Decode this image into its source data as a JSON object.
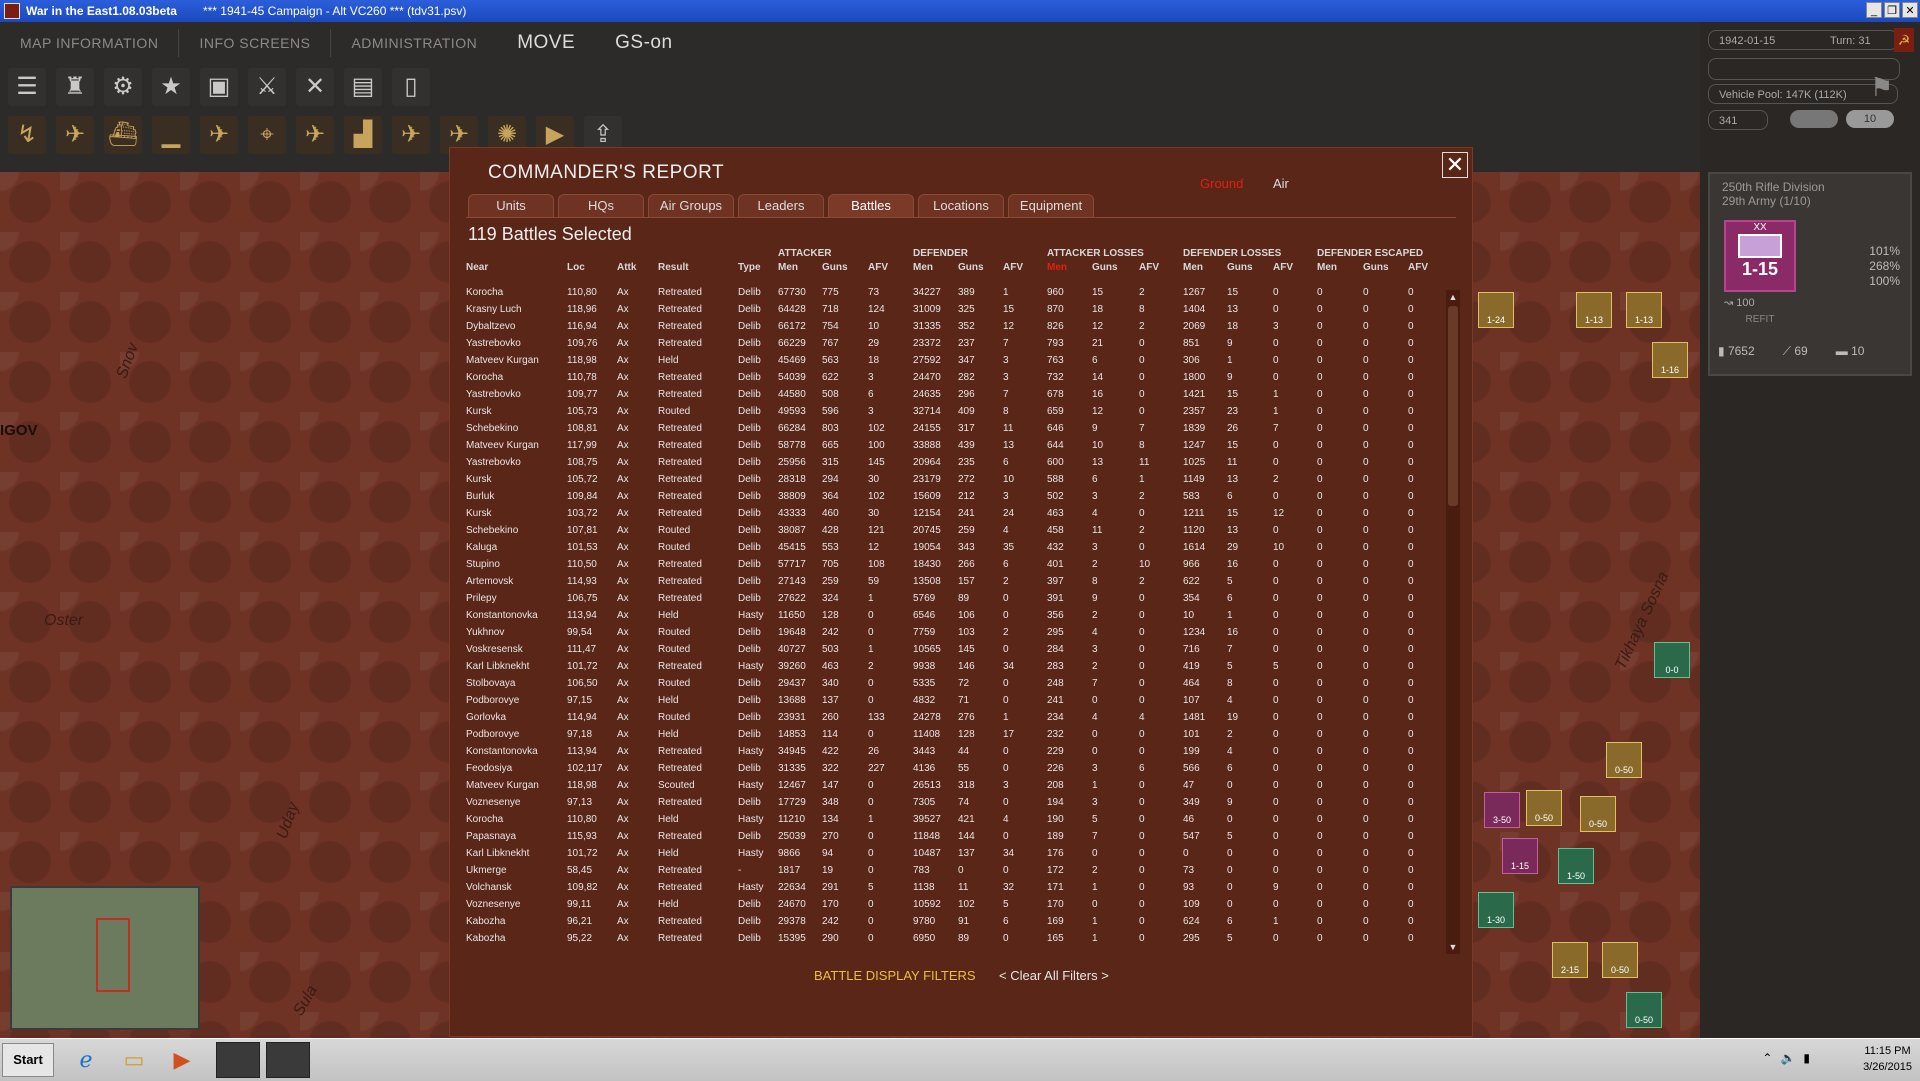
{
  "window": {
    "title": "War in the East1.08.03beta",
    "subtitle": "***  1941-45 Campaign - Alt VC260  ***  (tdv31.psv)"
  },
  "menu": {
    "map_information": "MAP INFORMATION",
    "info_screens": "INFO SCREENS",
    "administration": "ADMINISTRATION",
    "move": "MOVE",
    "gs_on": "GS-on"
  },
  "status": {
    "date": "1942-01-15",
    "turn": "Turn: 31",
    "vehicle_pool": "Vehicle Pool: 147K (112K)",
    "num": "341",
    "pill": "10"
  },
  "unit": {
    "name": "250th Rifle Division",
    "army": "29th Army (1/10)",
    "corps_mark": "XX",
    "strength": "1-15",
    "pct1": "101%",
    "pct2": "268%",
    "pct3": "100%",
    "support": "100",
    "refit": "REFIT",
    "men": "7652",
    "guns": "69",
    "afv": "10"
  },
  "map": {
    "city": "IGOV",
    "river1": "Snov",
    "river2": "Oster",
    "river3": "Uday",
    "river4": "Sula",
    "river5": "Tikhaya Sosna"
  },
  "dialog": {
    "title": "COMMANDER'S REPORT",
    "filter_ground": "Ground",
    "filter_air": "Air",
    "tabs": [
      "Units",
      "HQs",
      "Air Groups",
      "Leaders",
      "Battles",
      "Locations",
      "Equipment"
    ],
    "selected": "119 Battles Selected",
    "groups": {
      "attacker": "ATTACKER",
      "defender": "DEFENDER",
      "att_losses": "ATTACKER LOSSES",
      "def_losses": "DEFENDER LOSSES",
      "def_escaped": "DEFENDER ESCAPED"
    },
    "headers": {
      "near": "Near",
      "loc": "Loc",
      "attk": "Attk",
      "result": "Result",
      "type": "Type",
      "men": "Men",
      "guns": "Guns",
      "afv": "AFV"
    },
    "filters_label": "BATTLE DISPLAY FILTERS",
    "clear_filters": "< Clear All Filters >",
    "rows": [
      [
        "Korocha",
        "110,80",
        "Ax",
        "Retreated",
        "Delib",
        "67730",
        "775",
        "73",
        "34227",
        "389",
        "1",
        "960",
        "15",
        "2",
        "1267",
        "15",
        "0",
        "0",
        "0",
        "0"
      ],
      [
        "Krasny Luch",
        "118,96",
        "Ax",
        "Retreated",
        "Delib",
        "64428",
        "718",
        "124",
        "31009",
        "325",
        "15",
        "870",
        "18",
        "8",
        "1404",
        "13",
        "0",
        "0",
        "0",
        "0"
      ],
      [
        "Dybaltzevo",
        "116,94",
        "Ax",
        "Retreated",
        "Delib",
        "66172",
        "754",
        "10",
        "31335",
        "352",
        "12",
        "826",
        "12",
        "2",
        "2069",
        "18",
        "3",
        "0",
        "0",
        "0"
      ],
      [
        "Yastrebovko",
        "109,76",
        "Ax",
        "Retreated",
        "Delib",
        "66229",
        "767",
        "29",
        "23372",
        "237",
        "7",
        "793",
        "21",
        "0",
        "851",
        "9",
        "0",
        "0",
        "0",
        "0"
      ],
      [
        "Matveev Kurgan",
        "118,98",
        "Ax",
        "Held",
        "Delib",
        "45469",
        "563",
        "18",
        "27592",
        "347",
        "3",
        "763",
        "6",
        "0",
        "306",
        "1",
        "0",
        "0",
        "0",
        "0"
      ],
      [
        "Korocha",
        "110,78",
        "Ax",
        "Retreated",
        "Delib",
        "54039",
        "622",
        "3",
        "24470",
        "282",
        "3",
        "732",
        "14",
        "0",
        "1800",
        "9",
        "0",
        "0",
        "0",
        "0"
      ],
      [
        "Yastrebovko",
        "109,77",
        "Ax",
        "Retreated",
        "Delib",
        "44580",
        "508",
        "6",
        "24635",
        "296",
        "7",
        "678",
        "16",
        "0",
        "1421",
        "15",
        "1",
        "0",
        "0",
        "0"
      ],
      [
        "Kursk",
        "105,73",
        "Ax",
        "Routed",
        "Delib",
        "49593",
        "596",
        "3",
        "32714",
        "409",
        "8",
        "659",
        "12",
        "0",
        "2357",
        "23",
        "1",
        "0",
        "0",
        "0"
      ],
      [
        "Schebekino",
        "108,81",
        "Ax",
        "Retreated",
        "Delib",
        "66284",
        "803",
        "102",
        "24155",
        "317",
        "11",
        "646",
        "9",
        "7",
        "1839",
        "26",
        "7",
        "0",
        "0",
        "0"
      ],
      [
        "Matveev Kurgan",
        "117,99",
        "Ax",
        "Retreated",
        "Delib",
        "58778",
        "665",
        "100",
        "33888",
        "439",
        "13",
        "644",
        "10",
        "8",
        "1247",
        "15",
        "0",
        "0",
        "0",
        "0"
      ],
      [
        "Yastrebovko",
        "108,75",
        "Ax",
        "Retreated",
        "Delib",
        "25956",
        "315",
        "145",
        "20964",
        "235",
        "6",
        "600",
        "13",
        "11",
        "1025",
        "11",
        "0",
        "0",
        "0",
        "0"
      ],
      [
        "Kursk",
        "105,72",
        "Ax",
        "Retreated",
        "Delib",
        "28318",
        "294",
        "30",
        "23179",
        "272",
        "10",
        "588",
        "6",
        "1",
        "1149",
        "13",
        "2",
        "0",
        "0",
        "0"
      ],
      [
        "Burluk",
        "109,84",
        "Ax",
        "Retreated",
        "Delib",
        "38809",
        "364",
        "102",
        "15609",
        "212",
        "3",
        "502",
        "3",
        "2",
        "583",
        "6",
        "0",
        "0",
        "0",
        "0"
      ],
      [
        "Kursk",
        "103,72",
        "Ax",
        "Retreated",
        "Delib",
        "43333",
        "460",
        "30",
        "12154",
        "241",
        "24",
        "463",
        "4",
        "0",
        "1211",
        "15",
        "12",
        "0",
        "0",
        "0"
      ],
      [
        "Schebekino",
        "107,81",
        "Ax",
        "Routed",
        "Delib",
        "38087",
        "428",
        "121",
        "20745",
        "259",
        "4",
        "458",
        "11",
        "2",
        "1120",
        "13",
        "0",
        "0",
        "0",
        "0"
      ],
      [
        "Kaluga",
        "101,53",
        "Ax",
        "Routed",
        "Delib",
        "45415",
        "553",
        "12",
        "19054",
        "343",
        "35",
        "432",
        "3",
        "0",
        "1614",
        "29",
        "10",
        "0",
        "0",
        "0"
      ],
      [
        "Stupino",
        "110,50",
        "Ax",
        "Retreated",
        "Delib",
        "57717",
        "705",
        "108",
        "18430",
        "266",
        "6",
        "401",
        "2",
        "10",
        "966",
        "16",
        "0",
        "0",
        "0",
        "0"
      ],
      [
        "Artemovsk",
        "114,93",
        "Ax",
        "Retreated",
        "Delib",
        "27143",
        "259",
        "59",
        "13508",
        "157",
        "2",
        "397",
        "8",
        "2",
        "622",
        "5",
        "0",
        "0",
        "0",
        "0"
      ],
      [
        "Prilepy",
        "106,75",
        "Ax",
        "Retreated",
        "Delib",
        "27622",
        "324",
        "1",
        "5769",
        "89",
        "0",
        "391",
        "9",
        "0",
        "354",
        "6",
        "0",
        "0",
        "0",
        "0"
      ],
      [
        "Konstantonovka",
        "113,94",
        "Ax",
        "Held",
        "Hasty",
        "11650",
        "128",
        "0",
        "6546",
        "106",
        "0",
        "356",
        "2",
        "0",
        "10",
        "1",
        "0",
        "0",
        "0",
        "0"
      ],
      [
        "Yukhnov",
        "99,54",
        "Ax",
        "Routed",
        "Delib",
        "19648",
        "242",
        "0",
        "7759",
        "103",
        "2",
        "295",
        "4",
        "0",
        "1234",
        "16",
        "0",
        "0",
        "0",
        "0"
      ],
      [
        "Voskresensk",
        "111,47",
        "Ax",
        "Routed",
        "Delib",
        "40727",
        "503",
        "1",
        "10565",
        "145",
        "0",
        "284",
        "3",
        "0",
        "716",
        "7",
        "0",
        "0",
        "0",
        "0"
      ],
      [
        "Karl Libknekht",
        "101,72",
        "Ax",
        "Retreated",
        "Hasty",
        "39260",
        "463",
        "2",
        "9938",
        "146",
        "34",
        "283",
        "2",
        "0",
        "419",
        "5",
        "5",
        "0",
        "0",
        "0"
      ],
      [
        "Stolbovaya",
        "106,50",
        "Ax",
        "Routed",
        "Delib",
        "29437",
        "340",
        "0",
        "5335",
        "72",
        "0",
        "248",
        "7",
        "0",
        "464",
        "8",
        "0",
        "0",
        "0",
        "0"
      ],
      [
        "Podborovye",
        "97,15",
        "Ax",
        "Held",
        "Delib",
        "13688",
        "137",
        "0",
        "4832",
        "71",
        "0",
        "241",
        "0",
        "0",
        "107",
        "4",
        "0",
        "0",
        "0",
        "0"
      ],
      [
        "Gorlovka",
        "114,94",
        "Ax",
        "Routed",
        "Delib",
        "23931",
        "260",
        "133",
        "24278",
        "276",
        "1",
        "234",
        "4",
        "4",
        "1481",
        "19",
        "0",
        "0",
        "0",
        "0"
      ],
      [
        "Podborovye",
        "97,18",
        "Ax",
        "Held",
        "Delib",
        "14853",
        "114",
        "0",
        "11408",
        "128",
        "17",
        "232",
        "0",
        "0",
        "101",
        "2",
        "0",
        "0",
        "0",
        "0"
      ],
      [
        "Konstantonovka",
        "113,94",
        "Ax",
        "Retreated",
        "Hasty",
        "34945",
        "422",
        "26",
        "3443",
        "44",
        "0",
        "229",
        "0",
        "0",
        "199",
        "4",
        "0",
        "0",
        "0",
        "0"
      ],
      [
        "Feodosiya",
        "102,117",
        "Ax",
        "Retreated",
        "Delib",
        "31335",
        "322",
        "227",
        "4136",
        "55",
        "0",
        "226",
        "3",
        "6",
        "566",
        "6",
        "0",
        "0",
        "0",
        "0"
      ],
      [
        "Matveev Kurgan",
        "118,98",
        "Ax",
        "Scouted",
        "Hasty",
        "12467",
        "147",
        "0",
        "26513",
        "318",
        "3",
        "208",
        "1",
        "0",
        "47",
        "0",
        "0",
        "0",
        "0",
        "0"
      ],
      [
        "Voznesenye",
        "97,13",
        "Ax",
        "Retreated",
        "Delib",
        "17729",
        "348",
        "0",
        "7305",
        "74",
        "0",
        "194",
        "3",
        "0",
        "349",
        "9",
        "0",
        "0",
        "0",
        "0"
      ],
      [
        "Korocha",
        "110,80",
        "Ax",
        "Held",
        "Hasty",
        "11210",
        "134",
        "1",
        "39527",
        "421",
        "4",
        "190",
        "5",
        "0",
        "46",
        "0",
        "0",
        "0",
        "0",
        "0"
      ],
      [
        "Papasnaya",
        "115,93",
        "Ax",
        "Retreated",
        "Delib",
        "25039",
        "270",
        "0",
        "11848",
        "144",
        "0",
        "189",
        "7",
        "0",
        "547",
        "5",
        "0",
        "0",
        "0",
        "0"
      ],
      [
        "Karl Libknekht",
        "101,72",
        "Ax",
        "Held",
        "Hasty",
        "9866",
        "94",
        "0",
        "10487",
        "137",
        "34",
        "176",
        "0",
        "0",
        "0",
        "0",
        "0",
        "0",
        "0",
        "0"
      ],
      [
        "Ukmerge",
        "58,45",
        "Ax",
        "Retreated",
        "-",
        "1817",
        "19",
        "0",
        "783",
        "0",
        "0",
        "172",
        "2",
        "0",
        "73",
        "0",
        "0",
        "0",
        "0",
        "0"
      ],
      [
        "Volchansk",
        "109,82",
        "Ax",
        "Retreated",
        "Hasty",
        "22634",
        "291",
        "5",
        "1138",
        "11",
        "32",
        "171",
        "1",
        "0",
        "93",
        "0",
        "9",
        "0",
        "0",
        "0"
      ],
      [
        "Voznesenye",
        "99,11",
        "Ax",
        "Held",
        "Delib",
        "24670",
        "170",
        "0",
        "10592",
        "102",
        "5",
        "170",
        "0",
        "0",
        "109",
        "0",
        "0",
        "0",
        "0",
        "0"
      ],
      [
        "Kabozha",
        "96,21",
        "Ax",
        "Retreated",
        "Delib",
        "29378",
        "242",
        "0",
        "9780",
        "91",
        "6",
        "169",
        "1",
        "0",
        "624",
        "6",
        "1",
        "0",
        "0",
        "0"
      ],
      [
        "Kabozha",
        "95,22",
        "Ax",
        "Retreated",
        "Delib",
        "15395",
        "290",
        "0",
        "6950",
        "89",
        "0",
        "165",
        "1",
        "0",
        "295",
        "5",
        "0",
        "0",
        "0",
        "0"
      ]
    ]
  },
  "taskbar": {
    "start": "Start",
    "time": "11:15 PM",
    "date": "3/26/2015"
  }
}
